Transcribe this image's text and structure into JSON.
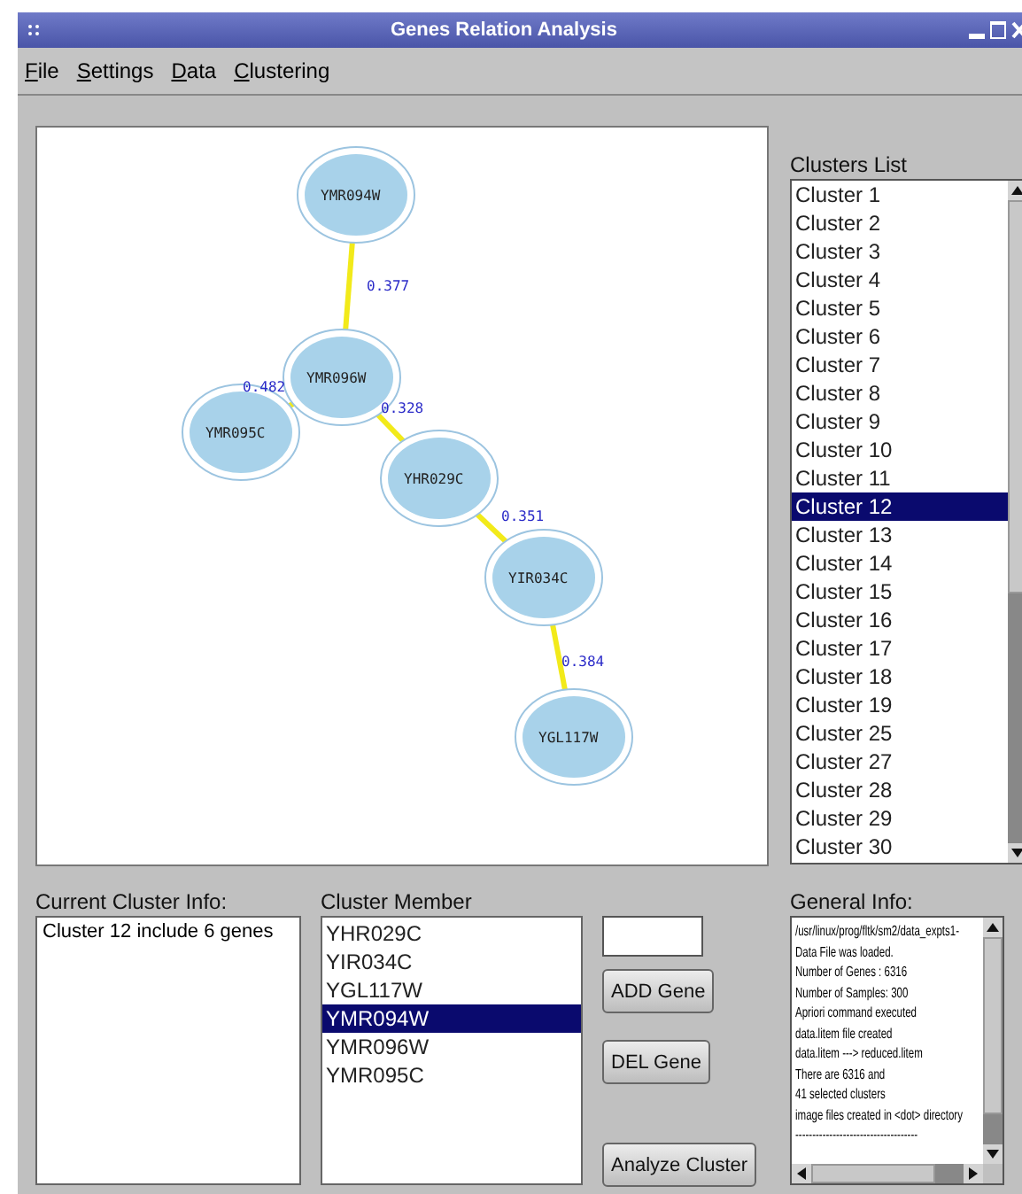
{
  "window": {
    "title": "Genes Relation Analysis"
  },
  "menu": [
    "File",
    "Settings",
    "Data",
    "Clustering"
  ],
  "graph": {
    "nodes": [
      {
        "label": "YMR094W"
      },
      {
        "label": "YMR096W"
      },
      {
        "label": "YMR095C"
      },
      {
        "label": "YHR029C"
      },
      {
        "label": "YIR034C"
      },
      {
        "label": "YGL117W"
      }
    ],
    "edges": [
      {
        "weight": "0.377"
      },
      {
        "weight": "0.482"
      },
      {
        "weight": "0.328"
      },
      {
        "weight": "0.351"
      },
      {
        "weight": "0.384"
      }
    ]
  },
  "clusters_list": {
    "label": "Clusters List",
    "items": [
      {
        "label": "Cluster 1",
        "selected": false
      },
      {
        "label": "Cluster 2",
        "selected": false
      },
      {
        "label": "Cluster 3",
        "selected": false
      },
      {
        "label": "Cluster 4",
        "selected": false
      },
      {
        "label": "Cluster 5",
        "selected": false
      },
      {
        "label": "Cluster 6",
        "selected": false
      },
      {
        "label": "Cluster 7",
        "selected": false
      },
      {
        "label": "Cluster 8",
        "selected": false
      },
      {
        "label": "Cluster 9",
        "selected": false
      },
      {
        "label": "Cluster 10",
        "selected": false
      },
      {
        "label": "Cluster 11",
        "selected": false
      },
      {
        "label": "Cluster 12",
        "selected": true
      },
      {
        "label": "Cluster 13",
        "selected": false
      },
      {
        "label": "Cluster 14",
        "selected": false
      },
      {
        "label": "Cluster 15",
        "selected": false
      },
      {
        "label": "Cluster 16",
        "selected": false
      },
      {
        "label": "Cluster 17",
        "selected": false
      },
      {
        "label": "Cluster 18",
        "selected": false
      },
      {
        "label": "Cluster 19",
        "selected": false
      },
      {
        "label": "Cluster 25",
        "selected": false
      },
      {
        "label": "Cluster 27",
        "selected": false
      },
      {
        "label": "Cluster 28",
        "selected": false
      },
      {
        "label": "Cluster 29",
        "selected": false
      },
      {
        "label": "Cluster 30",
        "selected": false
      }
    ]
  },
  "current_cluster_info": {
    "label": "Current Cluster Info:",
    "text": "Cluster 12 include 6 genes"
  },
  "cluster_member": {
    "label": "Cluster Member",
    "items": [
      {
        "label": "YHR029C",
        "selected": false
      },
      {
        "label": "YIR034C",
        "selected": false
      },
      {
        "label": "YGL117W",
        "selected": false
      },
      {
        "label": "YMR094W",
        "selected": true
      },
      {
        "label": "YMR096W",
        "selected": false
      },
      {
        "label": "YMR095C",
        "selected": false
      }
    ]
  },
  "buttons": [
    "ADD Gene",
    "DEL Gene",
    "Analyze Cluster"
  ],
  "general_info": {
    "label": "General Info:",
    "lines": [
      "/usr/linux/prog/fltk/sm2/data_expts1-",
      "Data File was loaded.",
      "Number of Genes : 6316",
      "Number of Samples: 300",
      "Apriori command executed",
      "data.litem file created",
      "data.litem ---> reduced.litem",
      "There are 6316 and",
      "41 selected clusters",
      "image files created in <dot> directory",
      "------------------------------------"
    ]
  }
}
